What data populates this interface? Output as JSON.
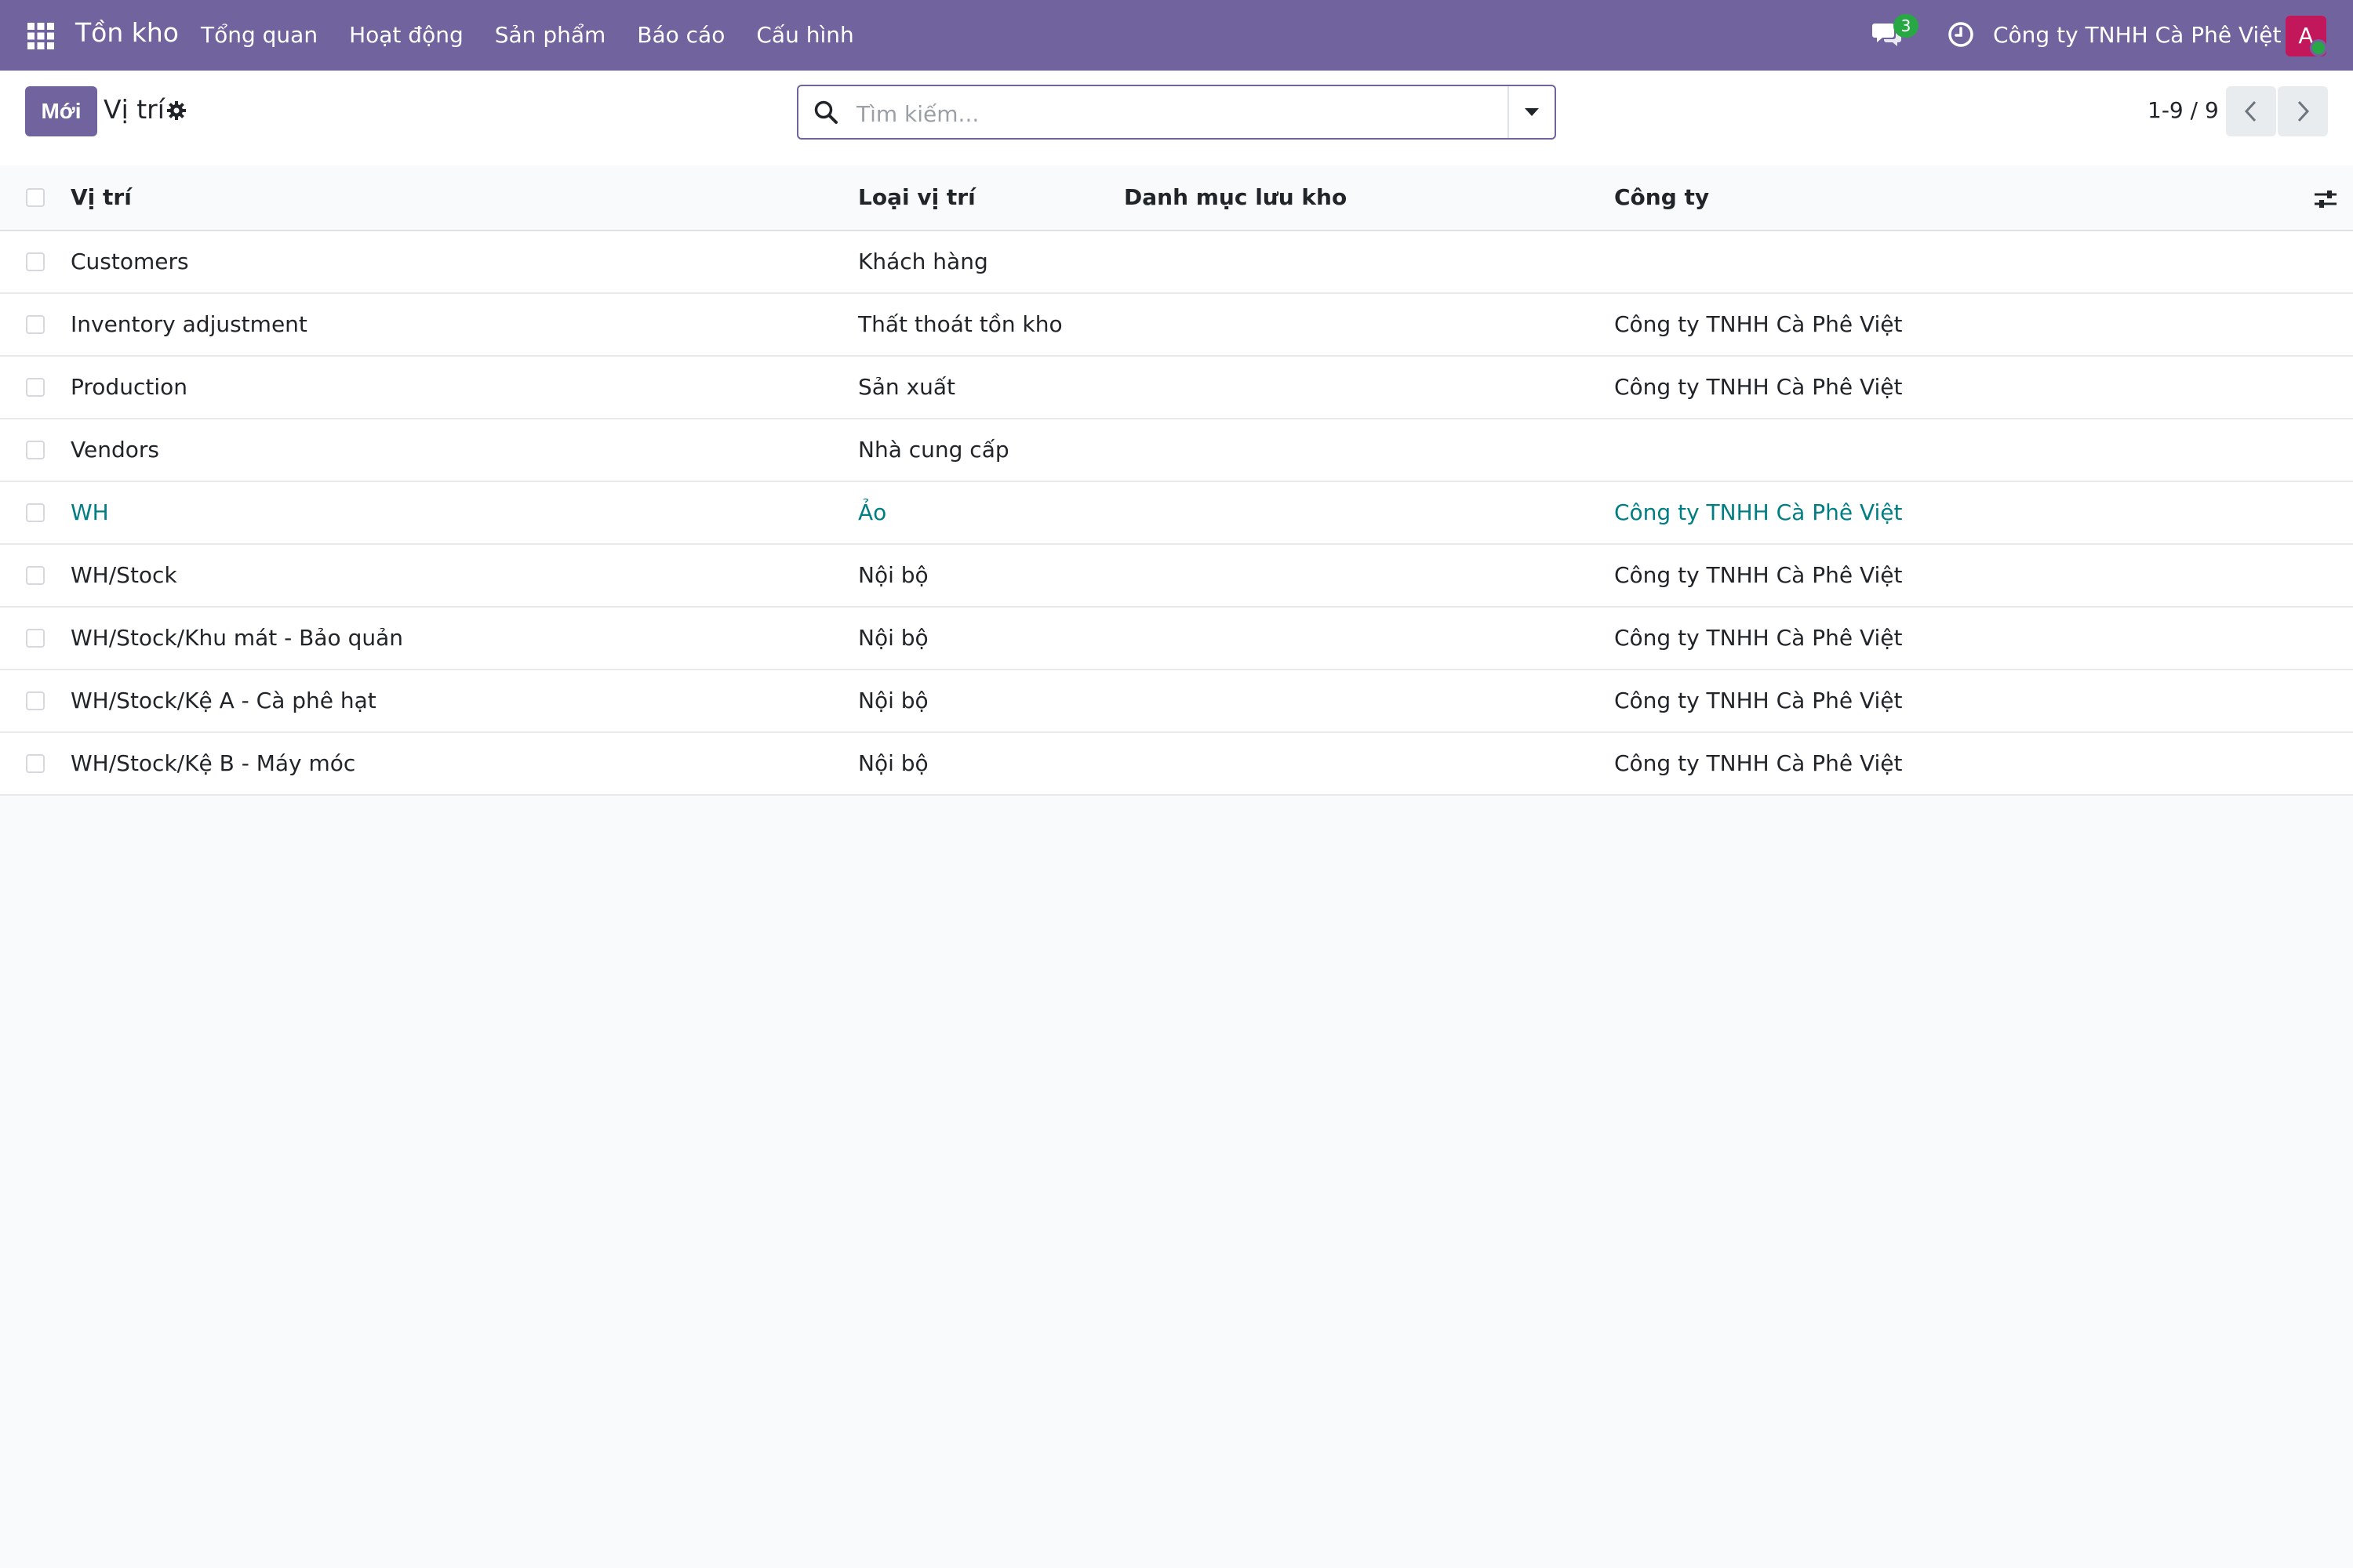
{
  "navbar": {
    "app_title": "Tồn kho",
    "menu": [
      "Tổng quan",
      "Hoạt động",
      "Sản phẩm",
      "Báo cáo",
      "Cấu hình"
    ],
    "message_count": "3",
    "company": "Công ty TNHH Cà Phê Việt",
    "avatar_letter": "A",
    "colors": {
      "navbar_bg": "#71639e",
      "badge": "#28a745",
      "avatar": "#c2185b"
    },
    "icons": [
      "apps-grid-icon",
      "chat-icon",
      "clock-icon"
    ]
  },
  "control_panel": {
    "new_button": "Mới",
    "title": "Vị trí",
    "search": {
      "placeholder": "Tìm kiếm...",
      "value": ""
    },
    "pager": "1-9 / 9",
    "icons": [
      "gear-icon",
      "search-icon",
      "caret-down-icon",
      "chevron-left-icon",
      "chevron-right-icon"
    ]
  },
  "table": {
    "columns": [
      "Vị trí",
      "Loại vị trí",
      "Danh mục lưu kho",
      "Công ty"
    ],
    "rows": [
      {
        "name": "Customers",
        "type": "Khách hàng",
        "category": "",
        "company": ""
      },
      {
        "name": "Inventory adjustment",
        "type": "Thất thoát tồn kho",
        "category": "",
        "company": "Công ty TNHH Cà Phê Việt"
      },
      {
        "name": "Production",
        "type": "Sản xuất",
        "category": "",
        "company": "Công ty TNHH Cà Phê Việt"
      },
      {
        "name": "Vendors",
        "type": "Nhà cung cấp",
        "category": "",
        "company": ""
      },
      {
        "name": "WH",
        "type": "Ảo",
        "category": "",
        "company": "Công ty TNHH Cà Phê Việt"
      },
      {
        "name": "WH/Stock",
        "type": "Nội bộ",
        "category": "",
        "company": "Công ty TNHH Cà Phê Việt"
      },
      {
        "name": "WH/Stock/Khu mát - Bảo quản",
        "type": "Nội bộ",
        "category": "",
        "company": "Công ty TNHH Cà Phê Việt"
      },
      {
        "name": "WH/Stock/Kệ A - Cà phê hạt",
        "type": "Nội bộ",
        "category": "",
        "company": "Công ty TNHH Cà Phê Việt"
      },
      {
        "name": "WH/Stock/Kệ B - Máy móc",
        "type": "Nội bộ",
        "category": "",
        "company": "Công ty TNHH Cà Phê Việt"
      }
    ],
    "link_color": "#017e84"
  }
}
